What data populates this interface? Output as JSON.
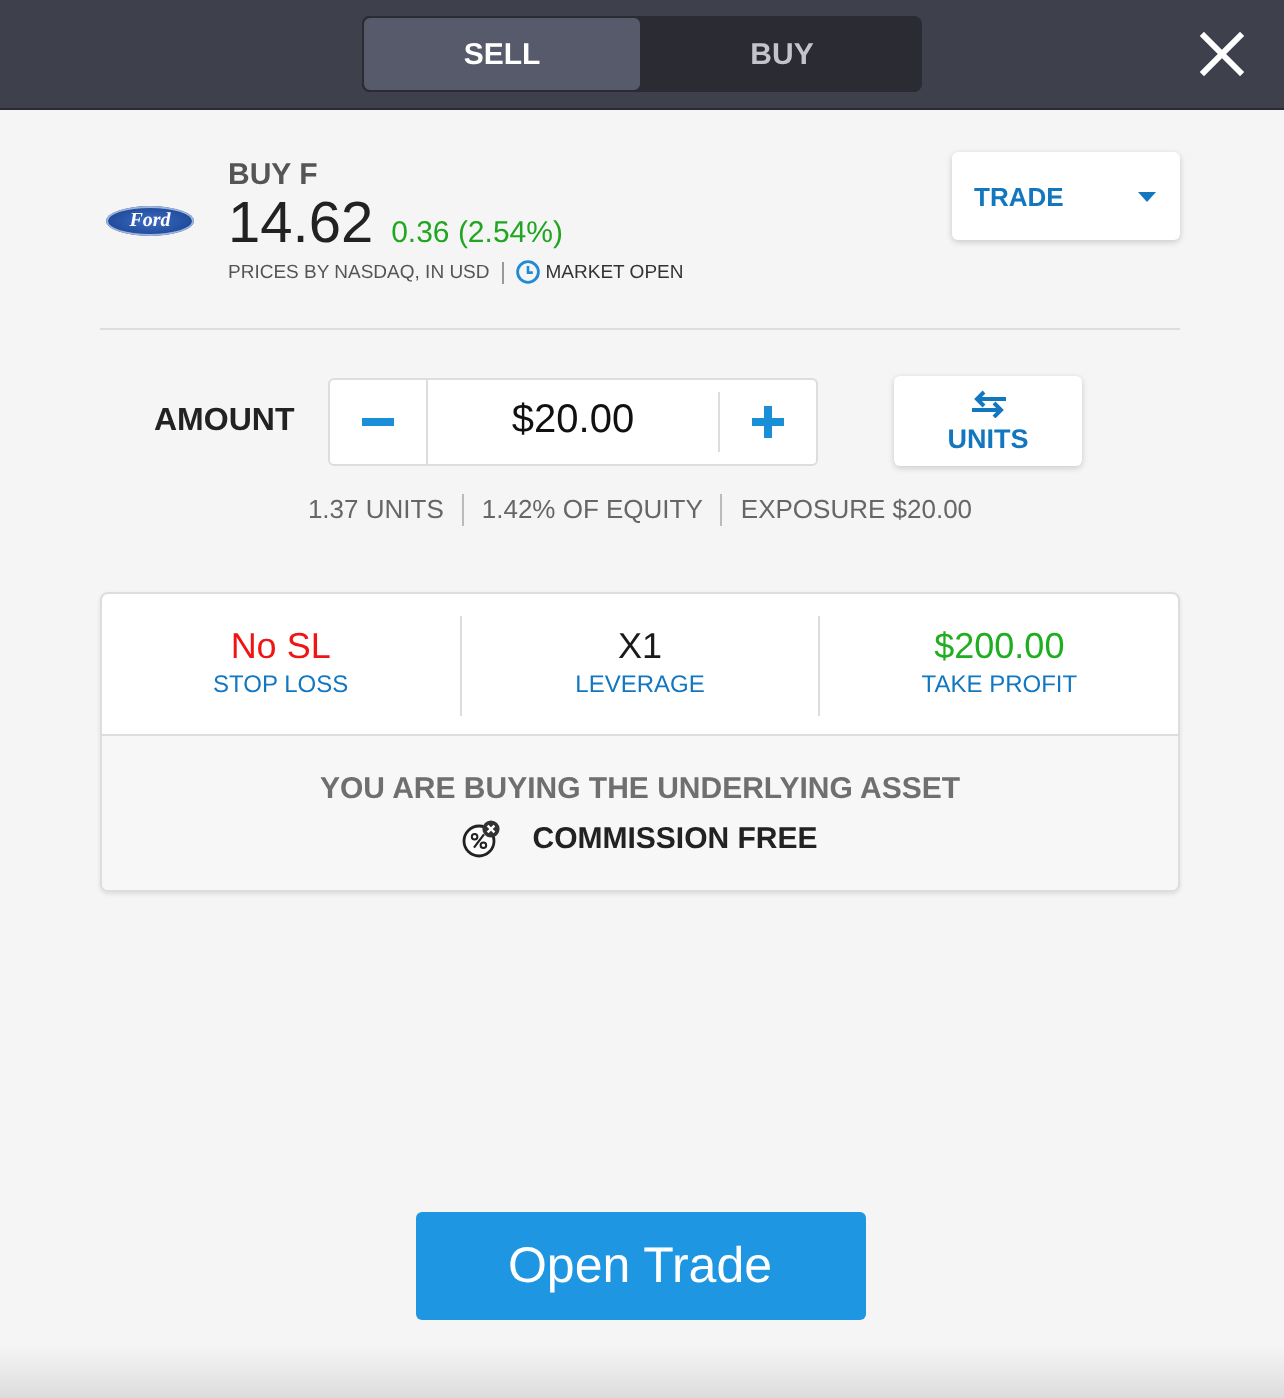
{
  "header": {
    "tabs": [
      {
        "label": "SELL",
        "selected": true
      },
      {
        "label": "BUY",
        "selected": false
      }
    ]
  },
  "instrument": {
    "logo_text": "Ford",
    "title": "BUY F",
    "price": "14.62",
    "change": "0.36 (2.54%)",
    "source": "PRICES BY NASDAQ, IN USD",
    "market_status": "MARKET OPEN"
  },
  "order_type": {
    "label": "TRADE"
  },
  "amount": {
    "label": "AMOUNT",
    "value": "$20.00",
    "toggle_label": "UNITS",
    "info": [
      "1.37 UNITS",
      "1.42% OF EQUITY",
      "EXPOSURE $20.00"
    ]
  },
  "settings": [
    {
      "value": "No SL",
      "label": "STOP LOSS",
      "color": "#f01414"
    },
    {
      "value": "X1",
      "label": "LEVERAGE",
      "color": "#1a1a1a"
    },
    {
      "value": "$200.00",
      "label": "TAKE PROFIT",
      "color": "#1fae1f"
    }
  ],
  "notice": {
    "text": "YOU ARE BUYING THE UNDERLYING ASSET",
    "commission": "COMMISSION FREE"
  },
  "submit": {
    "label": "Open Trade"
  }
}
